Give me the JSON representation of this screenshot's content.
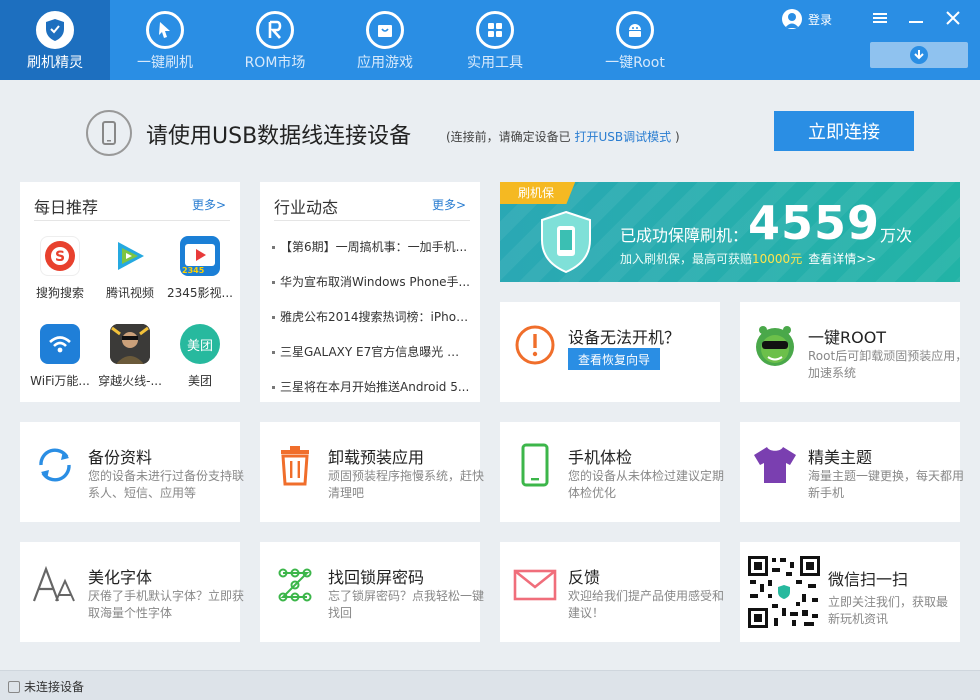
{
  "nav": [
    {
      "label": "刷机精灵",
      "icon": "shield-icon"
    },
    {
      "label": "一键刷机",
      "icon": "cursor-icon"
    },
    {
      "label": "ROM市场",
      "icon": "rom-icon"
    },
    {
      "label": "应用游戏",
      "icon": "bag-icon"
    },
    {
      "label": "实用工具",
      "icon": "grid-icon"
    },
    {
      "label": "一键Root",
      "icon": "android-icon"
    }
  ],
  "header": {
    "login_label": "登录"
  },
  "connect": {
    "message": "请使用USB数据线连接设备",
    "hint_prefix": "(连接前，请确定设备已",
    "hint_link": "打开USB调试模式",
    "hint_suffix": ")",
    "button_label": "立即连接"
  },
  "daily": {
    "title": "每日推荐",
    "more": "更多>",
    "apps": [
      {
        "label": "搜狗搜索",
        "color": "#e8412e"
      },
      {
        "label": "腾讯视频",
        "color": "#2b9bd6"
      },
      {
        "label": "2345影视...",
        "color": "#1b7fd6"
      },
      {
        "label": "WiFi万能...",
        "color": "#1f7fd8"
      },
      {
        "label": "穿越火线-...",
        "color": "#5a4a3a"
      },
      {
        "label": "美团",
        "color": "#27b99e"
      }
    ],
    "meituan_logo": "美团",
    "badge_2345": "2345"
  },
  "industry": {
    "title": "行业动态",
    "more": "更多>",
    "news": [
      "【第6期】一周搞机事：一加手机...",
      "华为宣布取消Windows Phone手...",
      "雅虎公布2014搜索热词榜：iPhon...",
      "三星GALAXY E7官方信息曝光 配5...",
      "三星将在本月开始推送Android 5..."
    ]
  },
  "banner": {
    "tag": "刷机保",
    "text": "已成功保障刷机：",
    "count": "4559",
    "unit": "万次",
    "sub_prefix": "加入刷机保，最高可获赔",
    "amount": "10000元",
    "detail": "查看详情>>"
  },
  "tiles": {
    "boot": {
      "title": "设备无法开机？",
      "button": "查看恢复向导"
    },
    "root": {
      "title": "一键ROOT",
      "desc": "Root后可卸载顽固预装应用，加速系统"
    },
    "backup": {
      "title": "备份资料",
      "desc": "您的设备未进行过备份支持联系人、短信、应用等"
    },
    "uninstall": {
      "title": "卸载预装应用",
      "desc": "顽固预装程序拖慢系统，赶快清理吧"
    },
    "check": {
      "title": "手机体检",
      "desc": "您的设备从未体检过建议定期体检优化"
    },
    "theme": {
      "title": "精美主题",
      "desc": "海量主题一键更换，每天都用新手机"
    },
    "font": {
      "title": "美化字体",
      "desc": "厌倦了手机默认字体？立即获取海量个性字体"
    },
    "lock": {
      "title": "找回锁屏密码",
      "desc": "忘了锁屏密码？点我轻松一键找回"
    },
    "feedback": {
      "title": "反馈",
      "desc": "欢迎给我们提产品使用感受和建议！"
    },
    "wechat": {
      "title": "微信扫一扫",
      "desc": "立即关注我们，获取最新玩机资讯"
    }
  },
  "status": {
    "text": "未连接设备"
  },
  "colors": {
    "primary": "#2a8ee4",
    "nav_active": "#1d6fbf",
    "banner": "#22b3a6",
    "accent_orange": "#f06e2b",
    "accent_green": "#3cb64a",
    "accent_purple": "#7a3fb0"
  }
}
